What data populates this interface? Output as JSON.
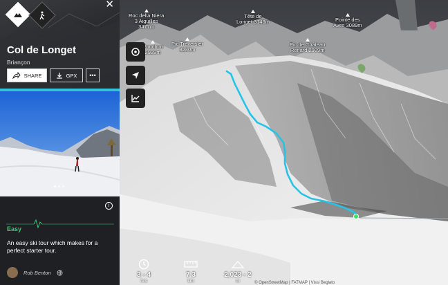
{
  "panel": {
    "title": "Col de Longet",
    "subtitle": "Briançon",
    "share_label": "SHARE",
    "gpx_label": "GPX",
    "more_label": "•••",
    "photo_dots": 3,
    "difficulty": "Easy",
    "description": "An easy ski tour which makes for a perfect starter tour.",
    "author": "Rob Benton"
  },
  "peaks": [
    {
      "name": "Roc della Niera\n3 Aiguilles\n3477m"
    },
    {
      "name": "Tête de\nLonget 3146m"
    },
    {
      "name": "Pointe des\nAves 3089m"
    },
    {
      "name": "Rouchon\n2929m"
    },
    {
      "name": "Pic Traversier\n3230m"
    },
    {
      "name": "Pic de Château\nRenard 2989m"
    }
  ],
  "stats": [
    {
      "icon": "clock-icon",
      "value": "3 - 4",
      "unit": "hrs"
    },
    {
      "icon": "ruler-icon",
      "value": "7.3",
      "unit": "km"
    },
    {
      "icon": "elevation-icon",
      "value": "2,023 - 2",
      "unit": "m"
    }
  ],
  "attribution": "© OpenStreetMap | FATMAP | Vissi Beglato"
}
